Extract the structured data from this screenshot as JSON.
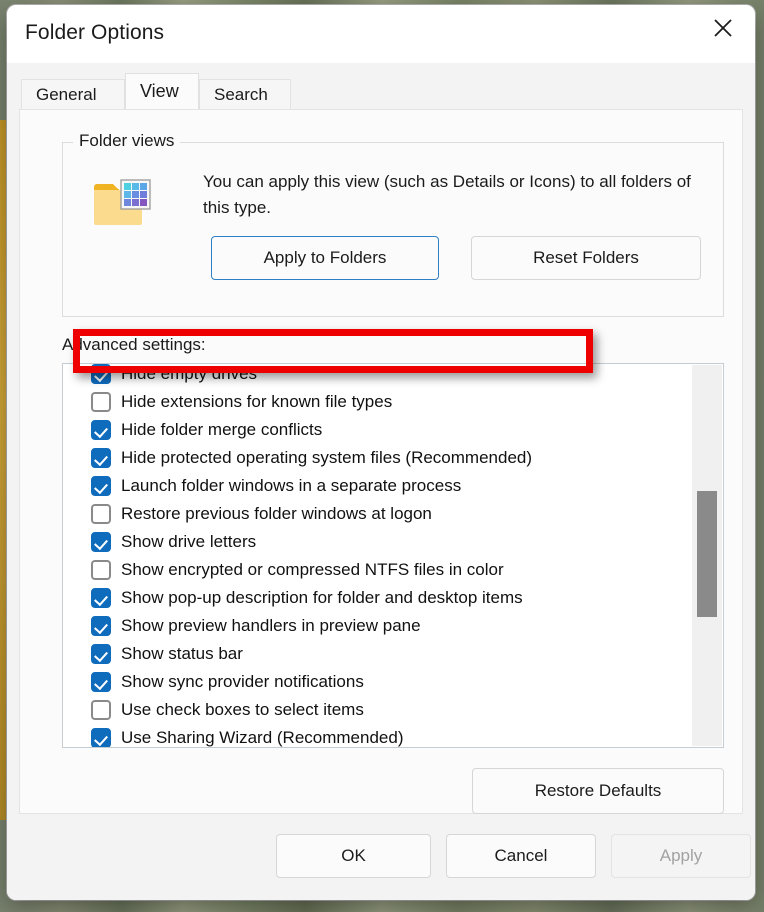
{
  "window": {
    "title": "Folder Options",
    "close_icon": "close-icon"
  },
  "tabs": [
    {
      "label": "General",
      "active": false
    },
    {
      "label": "View",
      "active": true
    },
    {
      "label": "Search",
      "active": false
    }
  ],
  "folder_views": {
    "legend": "Folder views",
    "icon": "folder-view-icon",
    "description": "You can apply this view (such as Details or Icons) to all folders of this type.",
    "apply_label": "Apply to Folders",
    "reset_label": "Reset Folders"
  },
  "advanced": {
    "label": "Advanced settings:",
    "items": [
      {
        "label": "Hide empty drives",
        "checked": true,
        "highlighted": false
      },
      {
        "label": "Hide extensions for known file types",
        "checked": false,
        "highlighted": false
      },
      {
        "label": "Hide folder merge conflicts",
        "checked": true,
        "highlighted": false
      },
      {
        "label": "Hide protected operating system files (Recommended)",
        "checked": true,
        "highlighted": false
      },
      {
        "label": "Launch folder windows in a separate process",
        "checked": true,
        "highlighted": true
      },
      {
        "label": "Restore previous folder windows at logon",
        "checked": false,
        "highlighted": false
      },
      {
        "label": "Show drive letters",
        "checked": true,
        "highlighted": false
      },
      {
        "label": "Show encrypted or compressed NTFS files in color",
        "checked": false,
        "highlighted": false
      },
      {
        "label": "Show pop-up description for folder and desktop items",
        "checked": true,
        "highlighted": false
      },
      {
        "label": "Show preview handlers in preview pane",
        "checked": true,
        "highlighted": false
      },
      {
        "label": "Show status bar",
        "checked": true,
        "highlighted": false
      },
      {
        "label": "Show sync provider notifications",
        "checked": true,
        "highlighted": false
      },
      {
        "label": "Use check boxes to select items",
        "checked": false,
        "highlighted": false
      },
      {
        "label": "Use Sharing Wizard (Recommended)",
        "checked": true,
        "highlighted": false
      }
    ],
    "restore_defaults_label": "Restore Defaults"
  },
  "footer": {
    "ok_label": "OK",
    "cancel_label": "Cancel",
    "apply_label": "Apply",
    "apply_enabled": false
  },
  "colors": {
    "checkbox_checked": "#0f6cbd",
    "accent_border": "#2f7fc4",
    "annotation": "#ee0000",
    "scrollbar_thumb": "#8a8a8a"
  }
}
